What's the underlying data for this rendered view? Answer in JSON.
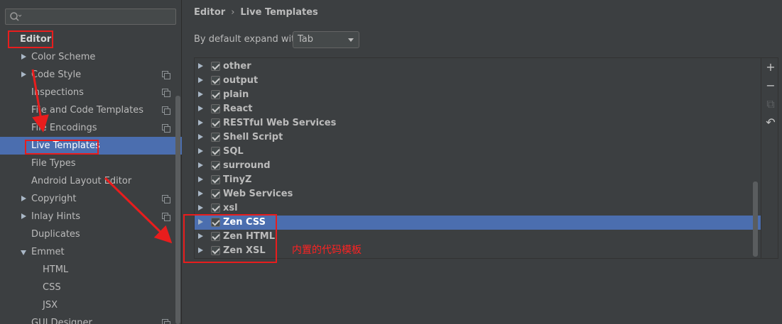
{
  "sidebar": {
    "search": {
      "value": "",
      "placeholder": ""
    },
    "items": [
      {
        "label": "Editor",
        "indent": 0,
        "bold": true
      },
      {
        "label": "Color Scheme",
        "indent": 1,
        "expander": "collapsed"
      },
      {
        "label": "Code Style",
        "indent": 1,
        "expander": "collapsed",
        "copy_icon": true
      },
      {
        "label": "Inspections",
        "indent": 1,
        "copy_icon": true
      },
      {
        "label": "File and Code Templates",
        "indent": 1,
        "copy_icon": true
      },
      {
        "label": "File Encodings",
        "indent": 1,
        "copy_icon": true
      },
      {
        "label": "Live Templates",
        "indent": 1,
        "selected": true
      },
      {
        "label": "File Types",
        "indent": 1
      },
      {
        "label": "Android Layout Editor",
        "indent": 1
      },
      {
        "label": "Copyright",
        "indent": 1,
        "expander": "collapsed",
        "copy_icon": true
      },
      {
        "label": "Inlay Hints",
        "indent": 1,
        "expander": "collapsed",
        "copy_icon": true
      },
      {
        "label": "Duplicates",
        "indent": 1
      },
      {
        "label": "Emmet",
        "indent": 1,
        "expander": "expanded"
      },
      {
        "label": "HTML",
        "indent": 2
      },
      {
        "label": "CSS",
        "indent": 2
      },
      {
        "label": "JSX",
        "indent": 2
      },
      {
        "label": "GUI Designer",
        "indent": 1,
        "copy_icon": true
      }
    ]
  },
  "main": {
    "breadcrumb": [
      "Editor",
      "Live Templates"
    ],
    "breadcrumb_separator": "›",
    "expand_label": "By default expand with",
    "expand_value": "Tab",
    "templates": [
      {
        "name": "other",
        "checked": true
      },
      {
        "name": "output",
        "checked": true
      },
      {
        "name": "plain",
        "checked": true
      },
      {
        "name": "React",
        "checked": true
      },
      {
        "name": "RESTful Web Services",
        "checked": true
      },
      {
        "name": "Shell Script",
        "checked": true
      },
      {
        "name": "SQL",
        "checked": true
      },
      {
        "name": "surround",
        "checked": true
      },
      {
        "name": "TinyZ",
        "checked": true
      },
      {
        "name": "Web Services",
        "checked": true
      },
      {
        "name": "xsl",
        "checked": true
      },
      {
        "name": "Zen CSS",
        "checked": true,
        "selected": true
      },
      {
        "name": "Zen HTML",
        "checked": true
      },
      {
        "name": "Zen XSL",
        "checked": true
      }
    ],
    "toolbar": [
      {
        "icon": "add-icon",
        "glyph": "+",
        "enabled": true
      },
      {
        "icon": "remove-icon",
        "glyph": "−",
        "enabled": true
      },
      {
        "icon": "copy-icon",
        "glyph": "⧉",
        "enabled": false
      },
      {
        "icon": "restore-icon",
        "glyph": "↶",
        "enabled": true
      }
    ]
  },
  "annotation": {
    "text": "内置的代码模板",
    "color": "#e81d1d"
  },
  "colors": {
    "background": "#3c3f41",
    "selection": "#4b6eaf",
    "text": "#bbbbbb"
  }
}
